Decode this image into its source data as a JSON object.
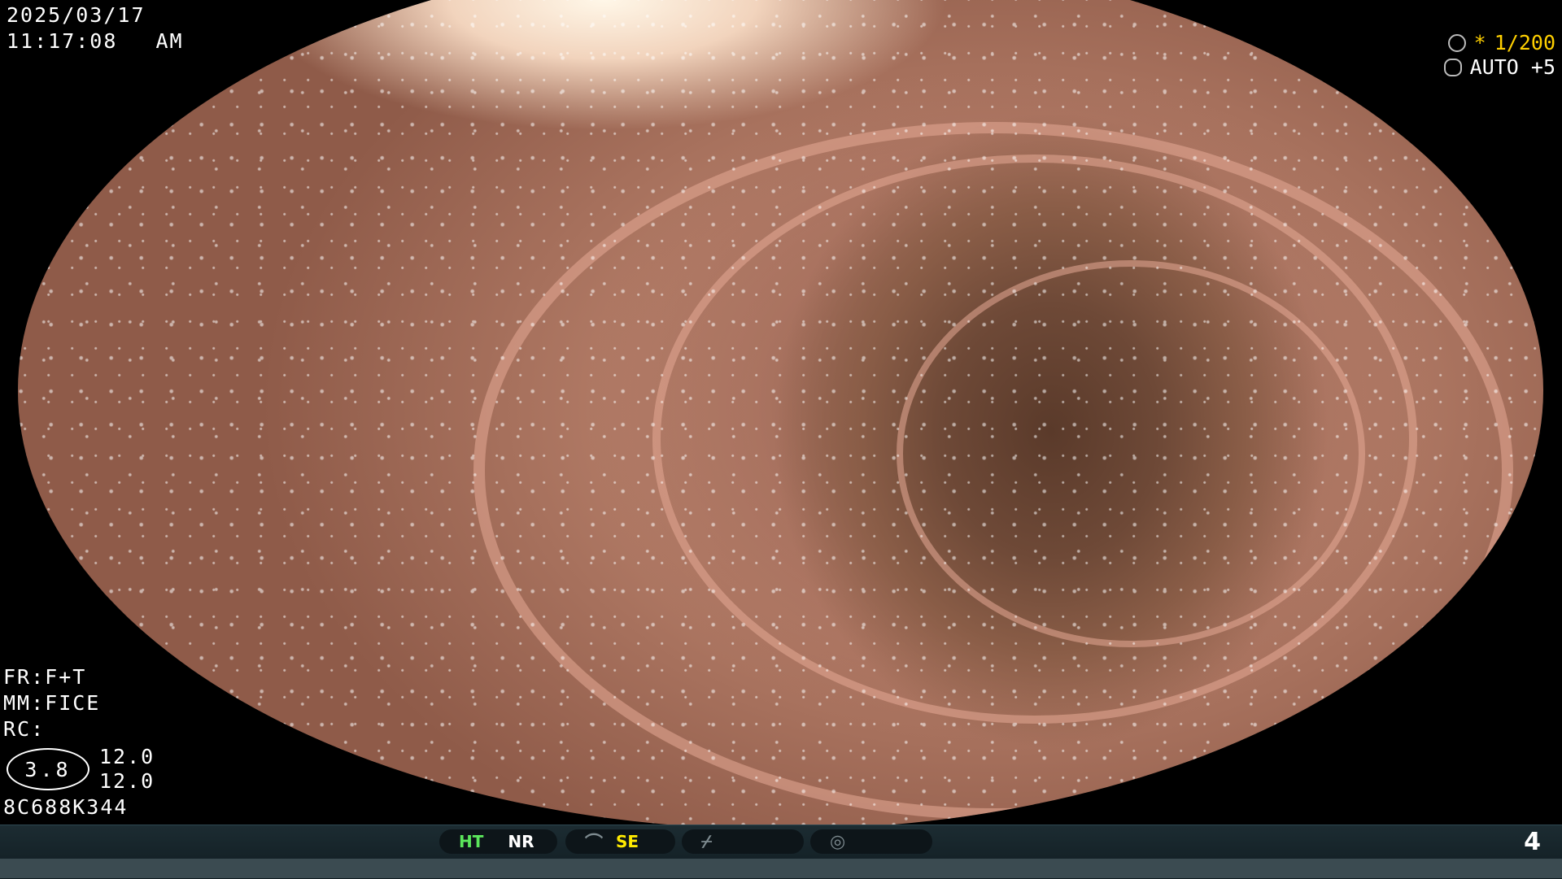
{
  "datetime": {
    "date": "2025/03/17",
    "time": "11:17:08",
    "ampm": "AM"
  },
  "top_right": {
    "shutter_icon": "aperture-icon",
    "shutter_prefix": "*",
    "shutter_value": "1/200",
    "iris_icon": "iris-icon",
    "iris_value": "AUTO +5"
  },
  "settings": {
    "fr": "FR:F+T",
    "mm": "MM:FICE",
    "rc": "RC:",
    "zoom_value": "3.8",
    "value_top": "12.0",
    "value_bottom": "12.0",
    "serial": "8C688K344"
  },
  "status_bar": {
    "ht": "HT",
    "nr": "NR",
    "se_icon": "curve-icon",
    "se": "SE",
    "slash_icon": "slash-curve-icon",
    "mode_icon": "waveform-icon",
    "page": "4",
    "colors": {
      "ht": "#5be65b",
      "se": "#ffea00"
    }
  }
}
